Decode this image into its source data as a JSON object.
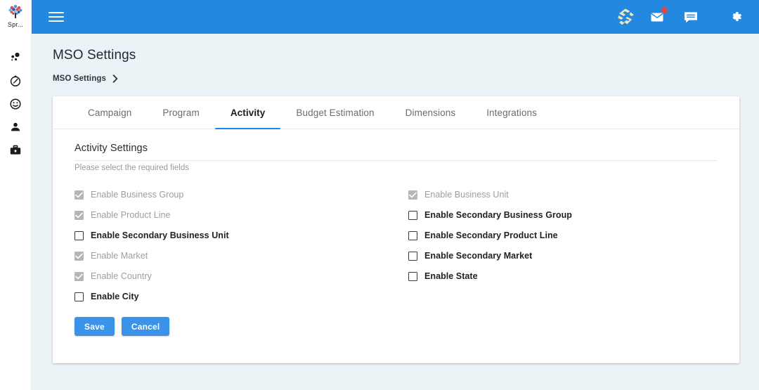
{
  "colors": {
    "header_blue": "#2388e0",
    "accent_blue": "#1e87e5",
    "button_blue": "#3a93e8",
    "page_bg": "#ecf3f6",
    "card_bg": "#ffffff",
    "checked_grey": "#b6b6b6",
    "badge_red": "#e8453c",
    "logo_cream": "#f2e3b8"
  },
  "rail": {
    "logo": {
      "icon": "tree-logo-icon",
      "label": "Spr..."
    },
    "items": [
      {
        "icon": "bubbles-icon",
        "name": "sidebar-item-bubbles"
      },
      {
        "icon": "timer-icon",
        "name": "sidebar-item-timer"
      },
      {
        "icon": "smiley-icon",
        "name": "sidebar-item-smiley"
      },
      {
        "icon": "person-icon",
        "name": "sidebar-item-person"
      },
      {
        "icon": "briefcase-icon",
        "name": "sidebar-item-briefcase"
      }
    ]
  },
  "topbar": {
    "menu_icon": "hamburger-menu-icon",
    "actions": [
      {
        "icon": "brand-knot-icon",
        "name": "brand-knot-icon",
        "badge": false
      },
      {
        "icon": "mail-icon",
        "name": "mail-icon",
        "badge": true
      },
      {
        "icon": "chat-icon",
        "name": "chat-icon",
        "badge": false
      },
      {
        "icon": "gear-icon",
        "name": "gear-icon",
        "badge": false
      }
    ]
  },
  "page": {
    "title": "MSO Settings",
    "breadcrumb": [
      "MSO Settings"
    ],
    "breadcrumb_chevron": "chevron-right-icon"
  },
  "tabs": [
    {
      "label": "Campaign",
      "active": false
    },
    {
      "label": "Program",
      "active": false
    },
    {
      "label": "Activity",
      "active": true
    },
    {
      "label": "Budget Estimation",
      "active": false
    },
    {
      "label": "Dimensions",
      "active": false
    },
    {
      "label": "Integrations",
      "active": false
    }
  ],
  "section": {
    "title": "Activity Settings",
    "subtitle": "Please select the required fields"
  },
  "checkboxes": {
    "left": [
      {
        "label": "Enable Business Group",
        "checked": true
      },
      {
        "label": "Enable Product Line",
        "checked": true
      },
      {
        "label": "Enable Secondary Business Unit",
        "checked": false
      },
      {
        "label": "Enable Market",
        "checked": true
      },
      {
        "label": "Enable Country",
        "checked": true
      },
      {
        "label": "Enable City",
        "checked": false
      }
    ],
    "right": [
      {
        "label": "Enable Business Unit",
        "checked": true
      },
      {
        "label": "Enable Secondary Business Group",
        "checked": false
      },
      {
        "label": "Enable Secondary Product Line",
        "checked": false
      },
      {
        "label": "Enable Secondary Market",
        "checked": false
      },
      {
        "label": "Enable State",
        "checked": false
      }
    ]
  },
  "buttons": {
    "save_label": "Save",
    "cancel_label": "Cancel"
  }
}
